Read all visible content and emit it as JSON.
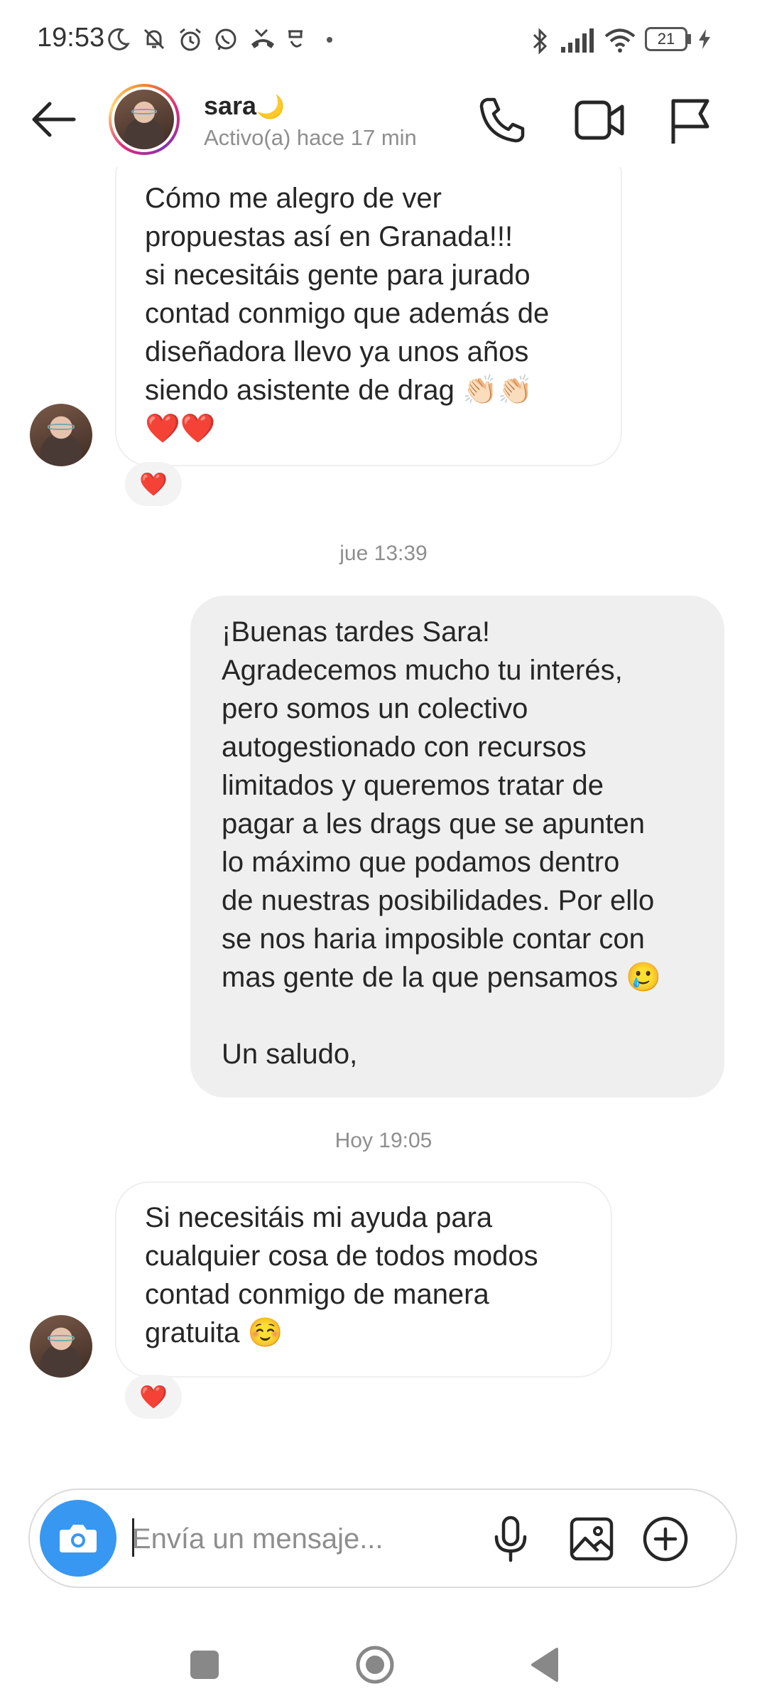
{
  "status_bar": {
    "time": "19:53",
    "battery": "21"
  },
  "header": {
    "name": "sara",
    "name_emoji": "🌙",
    "activity": "Activo(a) hace 17 min",
    "icons": [
      "back-arrow-icon",
      "phone-icon",
      "video-call-icon",
      "flag-icon"
    ]
  },
  "messages": {
    "first": {
      "lines": [
        "Cómo me alegro de ver",
        "propuestas así en Granada!!!",
        "si necesitáis gente para jurado",
        "contad conmigo que además de",
        "diseñadora llevo ya unos años",
        "siendo asistente de drag 👏🏻👏🏻",
        "❤️❤️"
      ],
      "reaction": "❤️"
    },
    "divider_1": "jue 13:39",
    "reply": {
      "lines": [
        "¡Buenas tardes Sara!",
        "Agradecemos mucho tu interés,",
        "pero somos un colectivo",
        "autogestionado con recursos",
        "limitados y queremos tratar de",
        "pagar a les drags que se apunten",
        "lo máximo que podamos dentro",
        "de nuestras posibilidades. Por ello",
        "se nos haria imposible contar con",
        "mas gente de la que pensamos 🥲",
        "",
        "Un saludo,"
      ]
    },
    "divider_2": "Hoy 19:05",
    "last": {
      "lines": [
        "Si necesitáis mi ayuda para",
        "cualquier cosa de todos modos",
        "contad conmigo de manera",
        "gratuita ☺️"
      ],
      "reaction": "❤️"
    }
  },
  "composer": {
    "placeholder": "Envía un mensaje...",
    "icons": [
      "camera-icon",
      "microphone-icon",
      "gallery-icon",
      "add-icon"
    ]
  },
  "navbar": {
    "icons": [
      "recents-icon",
      "home-icon",
      "back-icon"
    ]
  }
}
